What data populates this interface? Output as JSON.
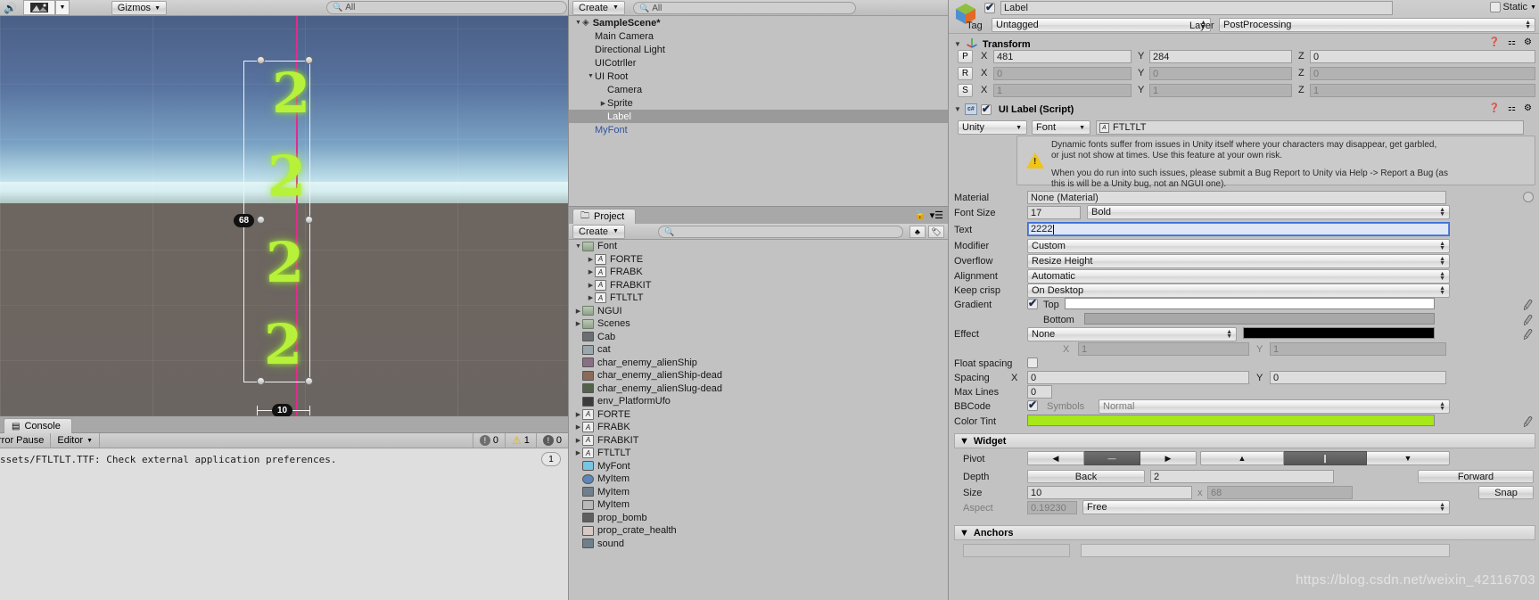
{
  "scene_view": {
    "toolbar": {
      "speaker_icon": "audio-icon",
      "image_icon": "image-effects-icon",
      "dropdown_icon": "chevron-down-icon",
      "gizmos_label": "Gizmos",
      "search_placeholder": "All",
      "search_icon": "search-icon"
    },
    "gizmo": {
      "height_label": "68",
      "width_label": "10",
      "glyphs": [
        "2",
        "2",
        "2",
        "2"
      ]
    }
  },
  "console": {
    "tab_label": "Console",
    "tab_icon": "console-icon",
    "error_pause_label": "rror Pause",
    "editor_label": "Editor",
    "editor_dropdown_icon": "chevron-down-icon",
    "info_icon": "info-icon",
    "info_count": "0",
    "warning_icon": "warning-icon",
    "warning_count": "1",
    "error_icon": "error-icon",
    "error_count": "0",
    "message": "ssets/FTLTLT.TTF: Check external application preferences.",
    "message_count": "1"
  },
  "hierarchy": {
    "create_label": "Create",
    "create_dropdown_icon": "chevron-down-icon",
    "search_placeholder": "All",
    "search_icon": "search-icon",
    "items": [
      {
        "label": "SampleScene*",
        "depth": 0,
        "tri": "▼",
        "icon": "unity-scene-icon",
        "selected": false,
        "bold": true
      },
      {
        "label": "Main Camera",
        "depth": 1,
        "tri": "",
        "selected": false
      },
      {
        "label": "Directional Light",
        "depth": 1,
        "tri": "",
        "selected": false
      },
      {
        "label": "UICotrller",
        "depth": 1,
        "tri": "",
        "selected": false
      },
      {
        "label": "UI Root",
        "depth": 1,
        "tri": "▼",
        "selected": false
      },
      {
        "label": "Camera",
        "depth": 2,
        "tri": "",
        "selected": false
      },
      {
        "label": "Sprite",
        "depth": 2,
        "tri": "▶",
        "selected": false
      },
      {
        "label": "Label",
        "depth": 2,
        "tri": "",
        "selected": true
      },
      {
        "label": "MyFont",
        "depth": 1,
        "tri": "",
        "selected": false,
        "prefab": true
      }
    ]
  },
  "project": {
    "tab_label": "Project",
    "tab_icon": "folder-icon",
    "lock_icon": "lock-icon",
    "menu_icon": "panel-menu-icon",
    "create_label": "Create",
    "create_dropdown_icon": "chevron-down-icon",
    "search_placeholder": "",
    "search_icon": "search-icon",
    "favorites_icon": "favorites-icon",
    "label_icon": "label-icon",
    "items": [
      {
        "label": "Font",
        "depth": 0,
        "tri": "▼",
        "icon": "folder"
      },
      {
        "label": "FORTE",
        "depth": 1,
        "tri": "▶",
        "icon": "font"
      },
      {
        "label": "FRABK",
        "depth": 1,
        "tri": "▶",
        "icon": "font"
      },
      {
        "label": "FRABKIT",
        "depth": 1,
        "tri": "▶",
        "icon": "font"
      },
      {
        "label": "FTLTLT",
        "depth": 1,
        "tri": "▶",
        "icon": "font"
      },
      {
        "label": "NGUI",
        "depth": 0,
        "tri": "▶",
        "icon": "folder"
      },
      {
        "label": "Scenes",
        "depth": 0,
        "tri": "▶",
        "icon": "folder"
      },
      {
        "label": "Cab",
        "depth": 0,
        "tri": "",
        "icon": "texture",
        "color": "#6b6f72"
      },
      {
        "label": "cat",
        "depth": 0,
        "tri": "",
        "icon": "texture",
        "color": "#9aa7ad"
      },
      {
        "label": "char_enemy_alienShip",
        "depth": 0,
        "tri": "",
        "icon": "texture",
        "color": "#8a6f84"
      },
      {
        "label": "char_enemy_alienShip-dead",
        "depth": 0,
        "tri": "",
        "icon": "texture",
        "color": "#8b6a58"
      },
      {
        "label": "char_enemy_alienSlug-dead",
        "depth": 0,
        "tri": "",
        "icon": "texture",
        "color": "#53634a"
      },
      {
        "label": "env_PlatformUfo",
        "depth": 0,
        "tri": "",
        "icon": "texture",
        "color": "#3b3b3b"
      },
      {
        "label": "FORTE",
        "depth": 0,
        "tri": "▶",
        "icon": "font"
      },
      {
        "label": "FRABK",
        "depth": 0,
        "tri": "▶",
        "icon": "font"
      },
      {
        "label": "FRABKIT",
        "depth": 0,
        "tri": "▶",
        "icon": "font"
      },
      {
        "label": "FTLTLT",
        "depth": 0,
        "tri": "▶",
        "icon": "font"
      },
      {
        "label": "MyFont",
        "depth": 0,
        "tri": "",
        "icon": "prefab",
        "color": "#78c5e5"
      },
      {
        "label": "MyItem",
        "depth": 0,
        "tri": "",
        "icon": "material",
        "color": "#5d87b8"
      },
      {
        "label": "MyItem",
        "depth": 0,
        "tri": "",
        "icon": "script",
        "color": "#6f7f8c"
      },
      {
        "label": "MyItem",
        "depth": 0,
        "tri": "",
        "icon": "misc",
        "color": "#b9b9b9"
      },
      {
        "label": "prop_bomb",
        "depth": 0,
        "tri": "",
        "icon": "texture",
        "color": "#5f5f5d"
      },
      {
        "label": "prop_crate_health",
        "depth": 0,
        "tri": "",
        "icon": "texture",
        "color": "#d9c9c5"
      },
      {
        "label": "sound",
        "depth": 0,
        "tri": "",
        "icon": "script",
        "color": "#6f7f8c"
      }
    ]
  },
  "inspector": {
    "game_object": {
      "icon": "game-object-icon",
      "enabled": true,
      "name": "Label",
      "static_label": "Static",
      "static_checked": false,
      "static_dropdown_icon": "chevron-down-icon",
      "tag_label": "Tag",
      "tag_value": "Untagged",
      "layer_label": "Layer",
      "layer_value": "PostProcessing"
    },
    "transform": {
      "foldout": "▼",
      "icon": "transform-icon",
      "title": "Transform",
      "help_icon": "help-icon",
      "preset_icon": "preset-icon",
      "gear_icon": "gear-icon",
      "rows": [
        {
          "tag": "P",
          "x_label": "X",
          "x": "481",
          "y_label": "Y",
          "y": "284",
          "z_label": "Z",
          "z": "0",
          "editable": true
        },
        {
          "tag": "R",
          "x_label": "X",
          "x": "0",
          "y_label": "Y",
          "y": "0",
          "z_label": "Z",
          "z": "0",
          "editable": false
        },
        {
          "tag": "S",
          "x_label": "X",
          "x": "1",
          "y_label": "Y",
          "y": "1",
          "z_label": "Z",
          "z": "1",
          "editable": false
        }
      ]
    },
    "ui_label": {
      "foldout": "▼",
      "script_icon": "csharp-script-icon",
      "enabled": true,
      "title": "UI Label (Script)",
      "help_icon": "help-icon",
      "preset_icon": "preset-icon",
      "gear_icon": "gear-icon",
      "font_source": "Unity",
      "font_type": "Font",
      "font_asset_icon": "font-asset-icon",
      "font_asset": "FTLTLT",
      "warning_icon": "warning-icon",
      "warning_line1": "Dynamic fonts suffer from issues in Unity itself where your characters may disappear, get garbled,",
      "warning_line2": "or just not show at times. Use this feature at your own risk.",
      "warning_line3": "When you do run into such issues, please submit a Bug Report to Unity via Help -> Report a Bug (as",
      "warning_line4": "this is will be a Unity bug, not an NGUI one).",
      "fields": {
        "material_label": "Material",
        "material_value": "None (Material)",
        "material_picker_icon": "object-picker-icon",
        "font_size_label": "Font Size",
        "font_size_value": "17",
        "font_style_value": "Bold",
        "text_label": "Text",
        "text_value": "2222",
        "modifier_label": "Modifier",
        "modifier_value": "Custom",
        "overflow_label": "Overflow",
        "overflow_value": "Resize Height",
        "alignment_label": "Alignment",
        "alignment_value": "Automatic",
        "keep_crisp_label": "Keep crisp",
        "keep_crisp_value": "On Desktop",
        "gradient_label": "Gradient",
        "gradient_checked": true,
        "gradient_top_label": "Top",
        "gradient_top_color": "#ffffff",
        "gradient_bottom_label": "Bottom",
        "gradient_bottom_color": "#a8a8a8",
        "effect_label": "Effect",
        "effect_value": "None",
        "effect_color": "#000000",
        "effect_x_label": "X",
        "effect_x_value": "1",
        "effect_y_label": "Y",
        "effect_y_value": "1",
        "float_spacing_label": "Float spacing",
        "float_spacing_checked": false,
        "spacing_label": "Spacing",
        "spacing_x_label": "X",
        "spacing_x_value": "0",
        "spacing_y_label": "Y",
        "spacing_y_value": "0",
        "max_lines_label": "Max Lines",
        "max_lines_value": "0",
        "bbcode_label": "BBCode",
        "bbcode_checked": true,
        "symbols_label": "Symbols",
        "symbols_value": "Normal",
        "color_tint_label": "Color Tint",
        "color_tint_color": "#a6e819",
        "eyedropper_icon": "eyedropper-icon"
      }
    },
    "widget": {
      "foldout": "▼",
      "title": "Widget",
      "pivot_label": "Pivot",
      "pivot_buttons": [
        "◀",
        "—",
        "▶",
        "▲",
        "❙",
        "▼"
      ],
      "pivot_selected": [
        1,
        4
      ],
      "depth_label": "Depth",
      "depth_back_label": "Back",
      "depth_value": "2",
      "depth_forward_label": "Forward",
      "size_label": "Size",
      "size_width": "10",
      "size_x_label": "x",
      "size_height": "68",
      "snap_label": "Snap",
      "aspect_label": "Aspect",
      "aspect_value": "0.19230",
      "aspect_mode": "Free"
    },
    "anchors": {
      "foldout": "▼",
      "title": "Anchors"
    },
    "watermark": "https://blog.csdn.net/weixin_42116703"
  }
}
